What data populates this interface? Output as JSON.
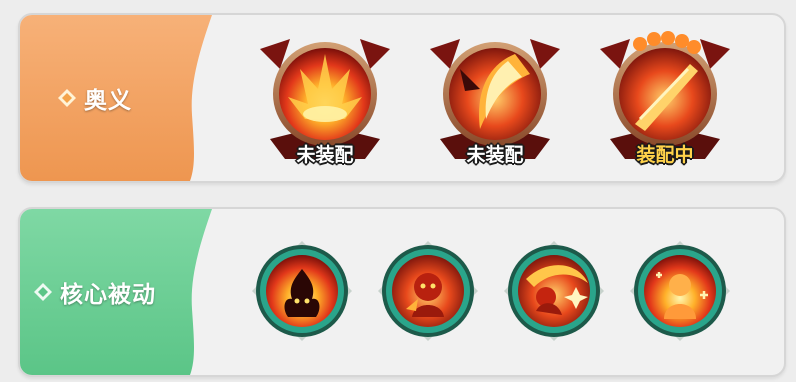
{
  "sections": {
    "ultimate": {
      "title": "奥义",
      "accent": "#f1a25e",
      "skills": [
        {
          "icon": "flame-burst-icon",
          "status": "未装配",
          "equipped": false
        },
        {
          "icon": "flame-slash-icon",
          "status": "未装配",
          "equipped": false
        },
        {
          "icon": "flame-blade-icon",
          "status": "装配中",
          "equipped": true
        }
      ]
    },
    "passive": {
      "title": "核心被动",
      "accent": "#6fcf97",
      "skills": [
        {
          "icon": "fire-spirit-icon"
        },
        {
          "icon": "fire-fist-icon"
        },
        {
          "icon": "fire-dash-icon"
        },
        {
          "icon": "fire-power-up-icon"
        }
      ]
    }
  },
  "colors": {
    "equipped_text": "#ffd24a",
    "unequipped_text": "#ffffff",
    "passive_ring": "#2aa58b"
  }
}
